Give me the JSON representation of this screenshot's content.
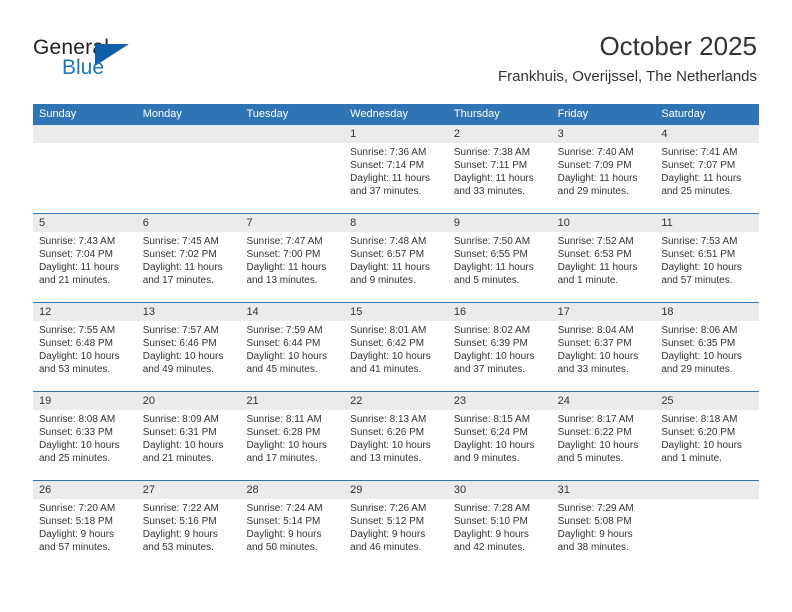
{
  "logo": {
    "word1": "General",
    "word2": "Blue",
    "triangle_color": "#0f5fa8",
    "blue_color": "#1f76bc"
  },
  "header": {
    "title": "October 2025",
    "subtitle": "Frankhuis, Overijssel, The Netherlands"
  },
  "theme": {
    "header_blue": "#2f75b5",
    "date_band_gray": "#ebebeb",
    "text": "#333333"
  },
  "weekdays": [
    "Sunday",
    "Monday",
    "Tuesday",
    "Wednesday",
    "Thursday",
    "Friday",
    "Saturday"
  ],
  "weeks": [
    [
      {
        "day": "",
        "sunrise": "",
        "sunset": "",
        "daylight": "",
        "empty": true
      },
      {
        "day": "",
        "sunrise": "",
        "sunset": "",
        "daylight": "",
        "empty": true
      },
      {
        "day": "",
        "sunrise": "",
        "sunset": "",
        "daylight": "",
        "empty": true
      },
      {
        "day": "1",
        "sunrise": "Sunrise: 7:36 AM",
        "sunset": "Sunset: 7:14 PM",
        "daylight": "Daylight: 11 hours and 37 minutes."
      },
      {
        "day": "2",
        "sunrise": "Sunrise: 7:38 AM",
        "sunset": "Sunset: 7:11 PM",
        "daylight": "Daylight: 11 hours and 33 minutes."
      },
      {
        "day": "3",
        "sunrise": "Sunrise: 7:40 AM",
        "sunset": "Sunset: 7:09 PM",
        "daylight": "Daylight: 11 hours and 29 minutes."
      },
      {
        "day": "4",
        "sunrise": "Sunrise: 7:41 AM",
        "sunset": "Sunset: 7:07 PM",
        "daylight": "Daylight: 11 hours and 25 minutes."
      }
    ],
    [
      {
        "day": "5",
        "sunrise": "Sunrise: 7:43 AM",
        "sunset": "Sunset: 7:04 PM",
        "daylight": "Daylight: 11 hours and 21 minutes."
      },
      {
        "day": "6",
        "sunrise": "Sunrise: 7:45 AM",
        "sunset": "Sunset: 7:02 PM",
        "daylight": "Daylight: 11 hours and 17 minutes."
      },
      {
        "day": "7",
        "sunrise": "Sunrise: 7:47 AM",
        "sunset": "Sunset: 7:00 PM",
        "daylight": "Daylight: 11 hours and 13 minutes."
      },
      {
        "day": "8",
        "sunrise": "Sunrise: 7:48 AM",
        "sunset": "Sunset: 6:57 PM",
        "daylight": "Daylight: 11 hours and 9 minutes."
      },
      {
        "day": "9",
        "sunrise": "Sunrise: 7:50 AM",
        "sunset": "Sunset: 6:55 PM",
        "daylight": "Daylight: 11 hours and 5 minutes."
      },
      {
        "day": "10",
        "sunrise": "Sunrise: 7:52 AM",
        "sunset": "Sunset: 6:53 PM",
        "daylight": "Daylight: 11 hours and 1 minute."
      },
      {
        "day": "11",
        "sunrise": "Sunrise: 7:53 AM",
        "sunset": "Sunset: 6:51 PM",
        "daylight": "Daylight: 10 hours and 57 minutes."
      }
    ],
    [
      {
        "day": "12",
        "sunrise": "Sunrise: 7:55 AM",
        "sunset": "Sunset: 6:48 PM",
        "daylight": "Daylight: 10 hours and 53 minutes."
      },
      {
        "day": "13",
        "sunrise": "Sunrise: 7:57 AM",
        "sunset": "Sunset: 6:46 PM",
        "daylight": "Daylight: 10 hours and 49 minutes."
      },
      {
        "day": "14",
        "sunrise": "Sunrise: 7:59 AM",
        "sunset": "Sunset: 6:44 PM",
        "daylight": "Daylight: 10 hours and 45 minutes."
      },
      {
        "day": "15",
        "sunrise": "Sunrise: 8:01 AM",
        "sunset": "Sunset: 6:42 PM",
        "daylight": "Daylight: 10 hours and 41 minutes."
      },
      {
        "day": "16",
        "sunrise": "Sunrise: 8:02 AM",
        "sunset": "Sunset: 6:39 PM",
        "daylight": "Daylight: 10 hours and 37 minutes."
      },
      {
        "day": "17",
        "sunrise": "Sunrise: 8:04 AM",
        "sunset": "Sunset: 6:37 PM",
        "daylight": "Daylight: 10 hours and 33 minutes."
      },
      {
        "day": "18",
        "sunrise": "Sunrise: 8:06 AM",
        "sunset": "Sunset: 6:35 PM",
        "daylight": "Daylight: 10 hours and 29 minutes."
      }
    ],
    [
      {
        "day": "19",
        "sunrise": "Sunrise: 8:08 AM",
        "sunset": "Sunset: 6:33 PM",
        "daylight": "Daylight: 10 hours and 25 minutes."
      },
      {
        "day": "20",
        "sunrise": "Sunrise: 8:09 AM",
        "sunset": "Sunset: 6:31 PM",
        "daylight": "Daylight: 10 hours and 21 minutes."
      },
      {
        "day": "21",
        "sunrise": "Sunrise: 8:11 AM",
        "sunset": "Sunset: 6:28 PM",
        "daylight": "Daylight: 10 hours and 17 minutes."
      },
      {
        "day": "22",
        "sunrise": "Sunrise: 8:13 AM",
        "sunset": "Sunset: 6:26 PM",
        "daylight": "Daylight: 10 hours and 13 minutes."
      },
      {
        "day": "23",
        "sunrise": "Sunrise: 8:15 AM",
        "sunset": "Sunset: 6:24 PM",
        "daylight": "Daylight: 10 hours and 9 minutes."
      },
      {
        "day": "24",
        "sunrise": "Sunrise: 8:17 AM",
        "sunset": "Sunset: 6:22 PM",
        "daylight": "Daylight: 10 hours and 5 minutes."
      },
      {
        "day": "25",
        "sunrise": "Sunrise: 8:18 AM",
        "sunset": "Sunset: 6:20 PM",
        "daylight": "Daylight: 10 hours and 1 minute."
      }
    ],
    [
      {
        "day": "26",
        "sunrise": "Sunrise: 7:20 AM",
        "sunset": "Sunset: 5:18 PM",
        "daylight": "Daylight: 9 hours and 57 minutes."
      },
      {
        "day": "27",
        "sunrise": "Sunrise: 7:22 AM",
        "sunset": "Sunset: 5:16 PM",
        "daylight": "Daylight: 9 hours and 53 minutes."
      },
      {
        "day": "28",
        "sunrise": "Sunrise: 7:24 AM",
        "sunset": "Sunset: 5:14 PM",
        "daylight": "Daylight: 9 hours and 50 minutes."
      },
      {
        "day": "29",
        "sunrise": "Sunrise: 7:26 AM",
        "sunset": "Sunset: 5:12 PM",
        "daylight": "Daylight: 9 hours and 46 minutes."
      },
      {
        "day": "30",
        "sunrise": "Sunrise: 7:28 AM",
        "sunset": "Sunset: 5:10 PM",
        "daylight": "Daylight: 9 hours and 42 minutes."
      },
      {
        "day": "31",
        "sunrise": "Sunrise: 7:29 AM",
        "sunset": "Sunset: 5:08 PM",
        "daylight": "Daylight: 9 hours and 38 minutes."
      },
      {
        "day": "",
        "sunrise": "",
        "sunset": "",
        "daylight": "",
        "empty": true
      }
    ]
  ]
}
